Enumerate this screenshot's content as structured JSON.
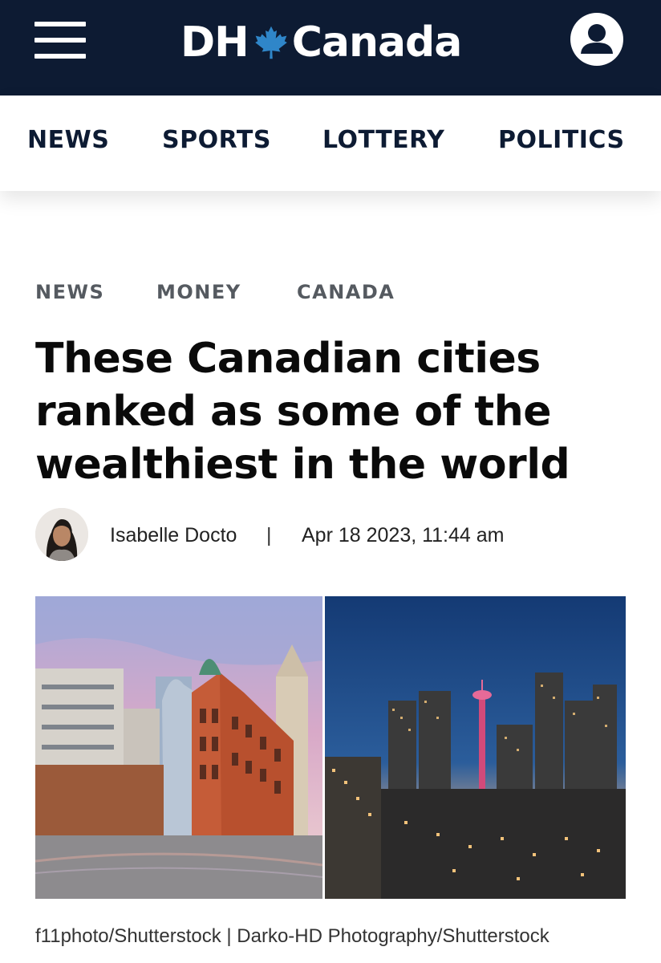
{
  "header": {
    "logo_left": "DH",
    "logo_right": "Canada",
    "menu_icon": "hamburger-menu-icon",
    "account_icon": "user-account-icon",
    "background_color": "#0d1b33"
  },
  "nav": {
    "items": [
      {
        "label": "NEWS"
      },
      {
        "label": "SPORTS"
      },
      {
        "label": "LOTTERY"
      },
      {
        "label": "POLITICS"
      }
    ]
  },
  "breadcrumbs": [
    "NEWS",
    "MONEY",
    "CANADA"
  ],
  "article": {
    "title": "These Canadian cities ranked as some of the wealthiest in the world",
    "author": "Isabelle Docto",
    "separator": "|",
    "date": "Apr 18 2023, 11:44 am",
    "image_caption": "f11photo/Shutterstock | Darko-HD Photography/Shutterstock"
  }
}
